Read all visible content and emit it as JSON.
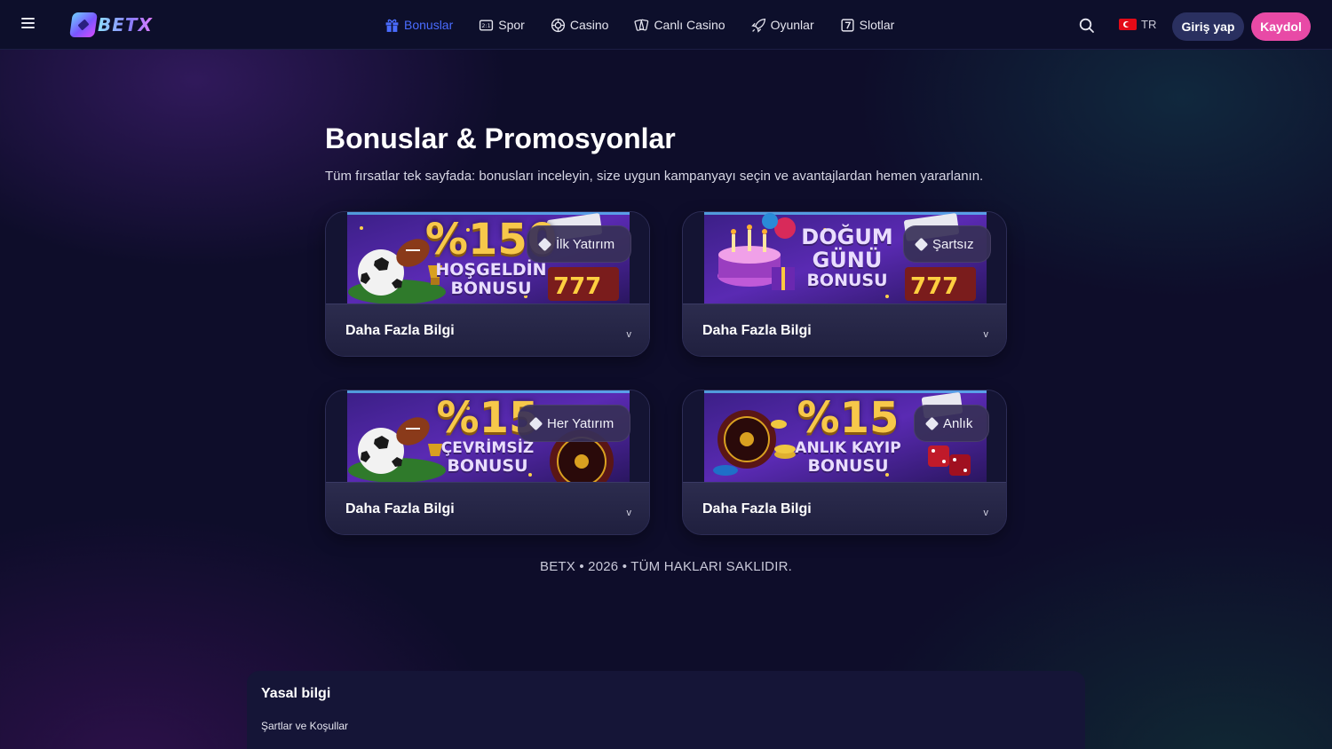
{
  "header": {
    "logo_text": "BETX",
    "nav": [
      {
        "label": "Bonuslar",
        "icon": "gift-icon",
        "active": true
      },
      {
        "label": "Spor",
        "icon": "scoreboard-icon"
      },
      {
        "label": "Casino",
        "icon": "casino-chip-icon"
      },
      {
        "label": "Canlı Casino",
        "icon": "cards-icon"
      },
      {
        "label": "Oyunlar",
        "icon": "rocket-icon"
      },
      {
        "label": "Slotlar",
        "icon": "slot-seven-icon"
      }
    ],
    "language": "TR",
    "login_label": "Giriş yap",
    "register_label": "Kaydol",
    "accent_color": "#4a6cff",
    "register_color": "#e84aa6"
  },
  "main": {
    "title": "Bonuslar & Promosyonlar",
    "subtitle": "Tüm fırsatlar tek sayfada: bonusları inceleyin, size uygun kampanyayı seçin ve avantajlardan hemen yararlanın.",
    "cards": [
      {
        "banner_big": "%150",
        "banner_line1": "HOŞGELDİN",
        "banner_line2": "BONUSU",
        "badge": "İlk Yatırım",
        "footer_label": "Daha Fazla Bilgi",
        "chevron": "v"
      },
      {
        "banner_big": "",
        "banner_line1": "DOĞUM",
        "banner_line2": "GÜNÜ",
        "banner_line3": "BONUSU",
        "badge": "Şartsız",
        "footer_label": "Daha Fazla Bilgi",
        "chevron": "v"
      },
      {
        "banner_big": "%15",
        "banner_line1": "ÇEVRİMSİZ",
        "banner_line2": "BONUSU",
        "badge": "Her Yatırım",
        "footer_label": "Daha Fazla Bilgi",
        "chevron": "v"
      },
      {
        "banner_big": "%15",
        "banner_line1": "ANLIK KAYIP",
        "banner_line2": "BONUSU",
        "badge": "Anlık",
        "footer_label": "Daha Fazla Bilgi",
        "chevron": "v"
      }
    ]
  },
  "footer": {
    "copyright": "BETX • 2026 • TÜM HAKLARI SAKLIDIR.",
    "legal_title": "Yasal bilgi",
    "legal_link": "Şartlar ve Koşullar"
  }
}
